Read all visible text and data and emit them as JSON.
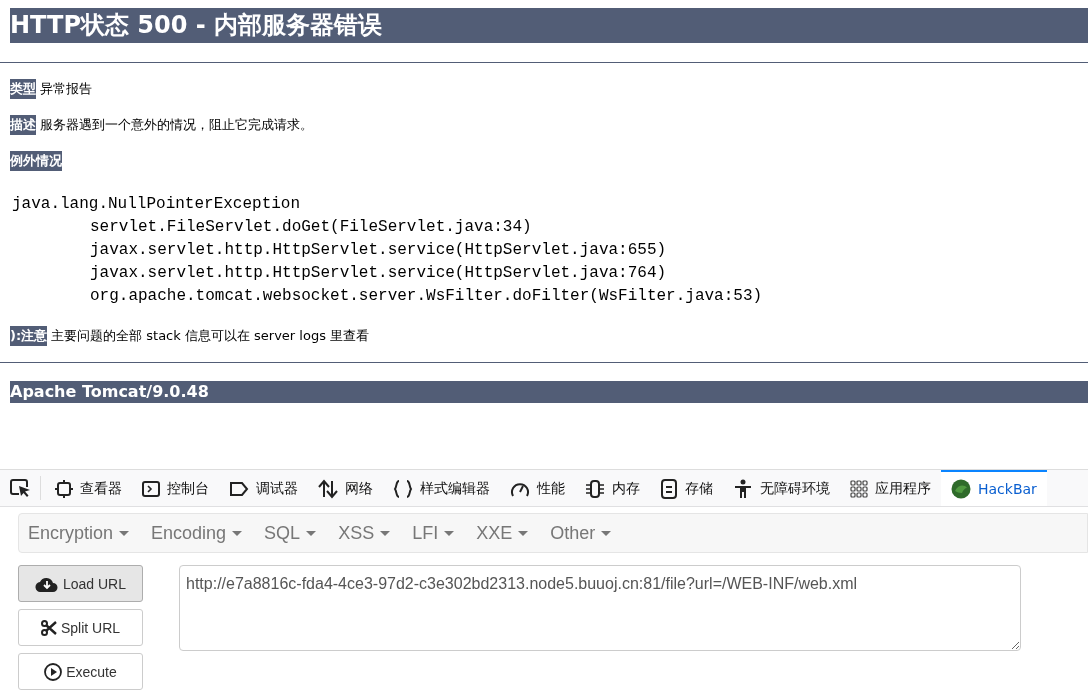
{
  "page": {
    "title": "HTTP状态 500 - 内部服务器错误",
    "fields": [
      {
        "label": "类型",
        "value": "异常报告"
      },
      {
        "label": "描述",
        "value": "服务器遇到一个意外的情况，阻止它完成请求。"
      }
    ],
    "exception_label": "例外情况",
    "exception": {
      "name": "java.lang.NullPointerException",
      "frames": [
        "servlet.FileServlet.doGet(FileServlet.java:34)",
        "javax.servlet.http.HttpServlet.service(HttpServlet.java:655)",
        "javax.servlet.http.HttpServlet.service(HttpServlet.java:764)",
        "org.apache.tomcat.websocket.server.WsFilter.doFilter(WsFilter.java:53)"
      ]
    },
    "note": {
      "label": "):注意",
      "value": "主要问题的全部 stack 信息可以在 server logs 里查看"
    },
    "footer": "Apache Tomcat/9.0.48"
  },
  "devtools_tabs": [
    {
      "kind": "inspector",
      "label": "查看器",
      "selected": false
    },
    {
      "kind": "console",
      "label": "控制台",
      "selected": false
    },
    {
      "kind": "debugger",
      "label": "调试器",
      "selected": false
    },
    {
      "kind": "network",
      "label": "网络",
      "selected": false
    },
    {
      "kind": "style",
      "label": "样式编辑器",
      "selected": false
    },
    {
      "kind": "performance",
      "label": "性能",
      "selected": false
    },
    {
      "kind": "memory",
      "label": "内存",
      "selected": false
    },
    {
      "kind": "storage",
      "label": "存储",
      "selected": false
    },
    {
      "kind": "accessibility",
      "label": "无障碍环境",
      "selected": false
    },
    {
      "kind": "apps",
      "label": "应用程序",
      "selected": false
    },
    {
      "kind": "hackbar",
      "label": "HackBar",
      "selected": true
    }
  ],
  "hackbar": {
    "menus": [
      "Encryption",
      "Encoding",
      "SQL",
      "XSS",
      "LFI",
      "XXE",
      "Other"
    ],
    "buttons": [
      {
        "kind": "load",
        "label": "Load URL",
        "pressed": true
      },
      {
        "kind": "split",
        "label": "Split URL",
        "pressed": false
      },
      {
        "kind": "execute",
        "label": "Execute",
        "pressed": false
      }
    ],
    "url": "http://e7a8816c-fda4-4ce3-97d2-c3e302bd2313.node5.buuoj.cn:81/file?url=/WEB-INF/web.xml"
  }
}
